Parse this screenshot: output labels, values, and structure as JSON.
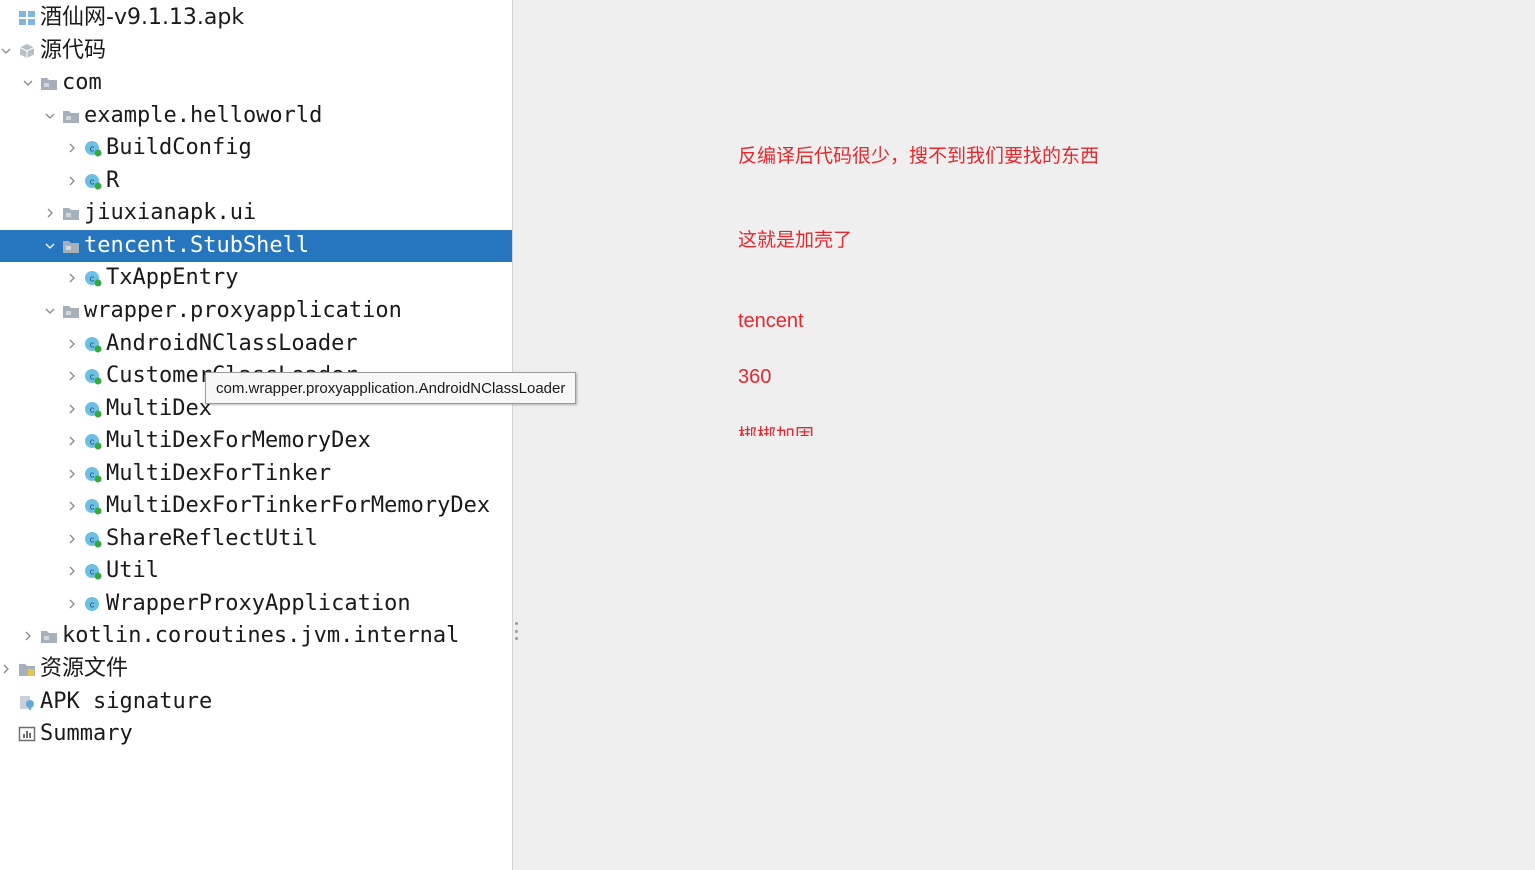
{
  "tree": {
    "rows": [
      {
        "label": "酒仙网-v9.1.13.apk",
        "indent": 0,
        "chevron": "none",
        "icon": "apk-icon"
      },
      {
        "label": "源代码",
        "indent": 0,
        "chevron": "down",
        "icon": "package-icon"
      },
      {
        "label": "com",
        "indent": 1,
        "chevron": "down",
        "icon": "folder-icon"
      },
      {
        "label": "example.helloworld",
        "indent": 2,
        "chevron": "down",
        "icon": "folder-icon"
      },
      {
        "label": "BuildConfig",
        "indent": 3,
        "chevron": "right",
        "icon": "class-icon"
      },
      {
        "label": "R",
        "indent": 3,
        "chevron": "right",
        "icon": "class-icon"
      },
      {
        "label": "jiuxianapk.ui",
        "indent": 2,
        "chevron": "right",
        "icon": "folder-icon"
      },
      {
        "label": "tencent.StubShell",
        "indent": 2,
        "chevron": "down",
        "icon": "folder-icon",
        "selected": true
      },
      {
        "label": "TxAppEntry",
        "indent": 3,
        "chevron": "right",
        "icon": "class-icon"
      },
      {
        "label": "wrapper.proxyapplication",
        "indent": 2,
        "chevron": "down",
        "icon": "folder-icon"
      },
      {
        "label": "AndroidNClassLoader",
        "indent": 3,
        "chevron": "right",
        "icon": "class-icon"
      },
      {
        "label": "CustomerClassLoader",
        "indent": 3,
        "chevron": "right",
        "icon": "class-icon"
      },
      {
        "label": "MultiDex",
        "indent": 3,
        "chevron": "right",
        "icon": "class-icon"
      },
      {
        "label": "MultiDexForMemoryDex",
        "indent": 3,
        "chevron": "right",
        "icon": "class-icon"
      },
      {
        "label": "MultiDexForTinker",
        "indent": 3,
        "chevron": "right",
        "icon": "class-icon"
      },
      {
        "label": "MultiDexForTinkerForMemoryDex",
        "indent": 3,
        "chevron": "right",
        "icon": "class-icon"
      },
      {
        "label": "ShareReflectUtil",
        "indent": 3,
        "chevron": "right",
        "icon": "class-icon"
      },
      {
        "label": "Util",
        "indent": 3,
        "chevron": "right",
        "icon": "class-icon"
      },
      {
        "label": "WrapperProxyApplication",
        "indent": 3,
        "chevron": "right",
        "icon": "class-plain-icon"
      },
      {
        "label": "kotlin.coroutines.jvm.internal",
        "indent": 1,
        "chevron": "right",
        "icon": "folder-icon"
      },
      {
        "label": "资源文件",
        "indent": 0,
        "chevron": "right",
        "icon": "resources-icon"
      },
      {
        "label": "APK signature",
        "indent": 0,
        "chevron": "none",
        "icon": "signature-icon"
      },
      {
        "label": "Summary",
        "indent": 0,
        "chevron": "none",
        "icon": "summary-icon"
      }
    ]
  },
  "tooltip": {
    "text": "com.wrapper.proxyapplication.AndroidNClassLoader"
  },
  "notes": {
    "line1": "反编译后代码很少，搜不到我们要找的东西",
    "line2": "这就是加壳了",
    "line3": "tencent",
    "line4": "360",
    "line5": "梆梆加固"
  },
  "colors": {
    "selection": "#2675bf",
    "note_text": "#e8272b",
    "class_icon": "#5fb3d9",
    "class_badge": "#3aa845",
    "folder": "#8a9aa8"
  }
}
